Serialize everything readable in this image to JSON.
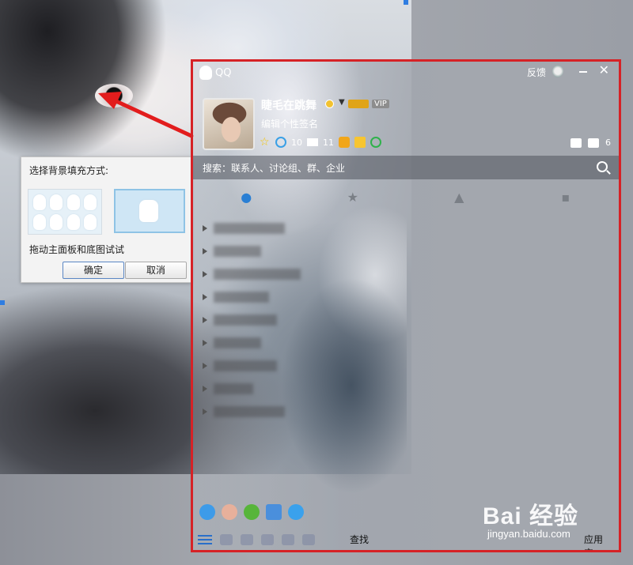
{
  "dialog": {
    "title": "选择背景填充方式:",
    "hint": "拖动主面板和底图试试",
    "ok_label": "确定",
    "cancel_label": "取消"
  },
  "qq": {
    "app_title": "QQ",
    "feedback_label": "反馈",
    "nickname": "睫毛在跳舞",
    "vip_badge": "VIP",
    "signature": "编辑个性签名",
    "stats": {
      "space_count": "10",
      "mail_count": "11"
    },
    "skin_count": "6",
    "search_placeholder": "搜索：联系人、讨论组、群、企业",
    "find_label": "查找",
    "app_box_label": "应用宝"
  },
  "watermark": {
    "brand": "Bai 经验",
    "url": "jingyan.baidu.com"
  },
  "colors": {
    "frame_red": "#d62226",
    "accent_blue": "#2a7fd4",
    "dialog_bg": "#f3f3f3"
  },
  "icons": [
    "qq-penguin-icon",
    "medal-icon",
    "minimize-icon",
    "close-icon",
    "star-icon",
    "space-icon",
    "mail-icon",
    "game-icon",
    "skin-icon",
    "search-icon",
    "contacts-icon",
    "menu-icon"
  ]
}
